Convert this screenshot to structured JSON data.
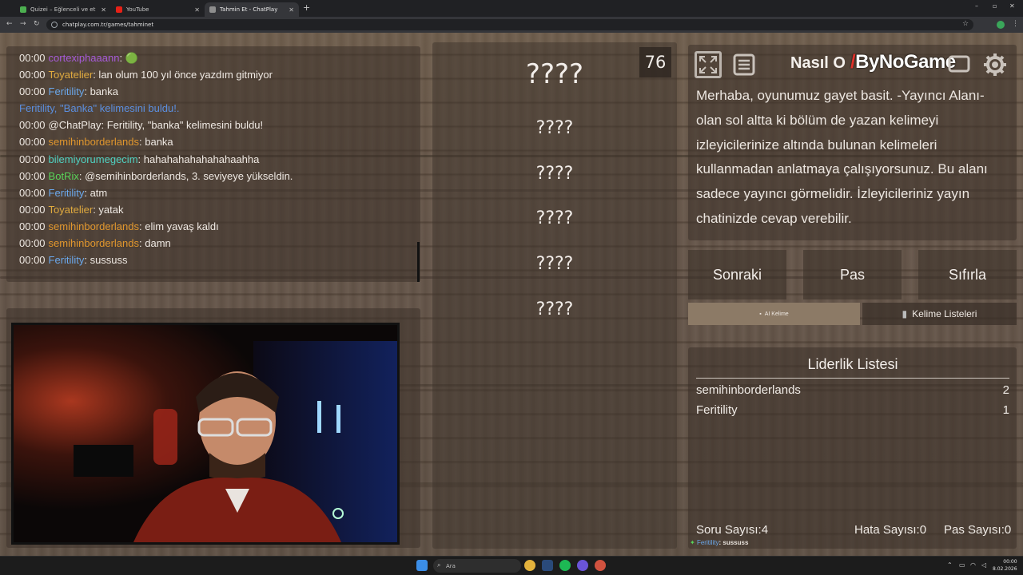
{
  "browser": {
    "tabs": [
      {
        "title": "Quizei – Eğlenceli ve etkileşimli",
        "active": false
      },
      {
        "title": "YouTube",
        "active": false
      },
      {
        "title": "Tahmin Et - ChatPlay",
        "active": true
      }
    ],
    "url": "chatplay.com.tr/games/tahminet"
  },
  "chat": {
    "lines": [
      {
        "time": "00:00",
        "user": "cortexiphaaann",
        "sep": ":",
        "msg": " 🟢",
        "color": "#a65ad8",
        "msgcolor": "#efe9e3"
      },
      {
        "time": "00:00",
        "user": "Toyatelier",
        "sep": ":",
        "msg": " lan olum 100 yıl önce yazdım gitmiyor",
        "color": "#e0aa3e",
        "msgcolor": "#efe9e3"
      },
      {
        "time": "00:00",
        "user": "Feritility",
        "sep": ":",
        "msg": " banka",
        "color": "#6aa7ea",
        "msgcolor": "#efe9e3"
      },
      {
        "time": "",
        "user": "",
        "sep": "",
        "msg": "Feritility, \"Banka\" kelimesini buldu!.",
        "color": "#6aa7ea",
        "msgcolor": "#5b8fe0"
      },
      {
        "time": "00:00",
        "user": "@ChatPlay",
        "sep": ":",
        "msg": " Feritility, \"banka\" kelimesini buldu!",
        "color": "#efe9e3",
        "msgcolor": "#efe9e3"
      },
      {
        "time": "00:00",
        "user": "semihinborderlands",
        "sep": ":",
        "msg": " banka",
        "color": "#e0962d",
        "msgcolor": "#efe9e3"
      },
      {
        "time": "00:00",
        "user": "bilemiyorumegecim",
        "sep": ":",
        "msg": " hahahahahahahahaahha",
        "color": "#4fd1c1",
        "msgcolor": "#efe9e3"
      },
      {
        "time": "00:00",
        "user": "BotRix",
        "sep": ":",
        "msg": " @semihinborderlands, 3. seviyeye yükseldin.",
        "color": "#59d65a",
        "msgcolor": "#efe9e3"
      },
      {
        "time": "00:00",
        "user": "Feritility",
        "sep": ":",
        "msg": " atm",
        "color": "#6aa7ea",
        "msgcolor": "#efe9e3"
      },
      {
        "time": "00:00",
        "user": "Toyatelier",
        "sep": ":",
        "msg": " yatak",
        "color": "#e0aa3e",
        "msgcolor": "#efe9e3"
      },
      {
        "time": "00:00",
        "user": "semihinborderlands",
        "sep": ":",
        "msg": " elim yavaş kaldı",
        "color": "#e0962d",
        "msgcolor": "#efe9e3"
      },
      {
        "time": "00:00",
        "user": "semihinborderlands",
        "sep": ":",
        "msg": " damn",
        "color": "#e0962d",
        "msgcolor": "#efe9e3"
      },
      {
        "time": "00:00",
        "user": "Feritility",
        "sep": ":",
        "msg": " sussuss",
        "color": "#6aa7ea",
        "msgcolor": "#efe9e3"
      }
    ]
  },
  "game": {
    "timer": "76",
    "words": [
      "????",
      "????",
      "????",
      "????",
      "????",
      "????"
    ]
  },
  "howto": {
    "title": "Nasıl O",
    "logo_a": "By",
    "logo_b": "NoGame",
    "text": "Merhaba, oyunumuz gayet basit. -Yayıncı Alanı- olan sol altta ki bölüm de yazan kelimeyi izleyicilerinize altında bulunan kelimeleri kullanmadan anlatmaya çalışıyorsunuz. Bu alanı sadece yayıncı görmelidir. İzleyicileriniz yayın chatinizde cevap verebilir."
  },
  "controls": {
    "next": "Sonraki",
    "pass": "Pas",
    "reset": "Sıfırla",
    "ai_word": "AI Kelime",
    "word_lists": "Kelime Listeleri"
  },
  "leaderboard": {
    "title": "Liderlik Listesi",
    "rows": [
      {
        "name": "semihinborderlands",
        "score": "2"
      },
      {
        "name": "Feritility",
        "score": "1"
      }
    ],
    "question_count": "Soru Sayısı:4",
    "error_count": "Hata Sayısı:0",
    "pass_count": "Pas Sayısı:0",
    "last_chat_user": "Feritility",
    "last_chat_msg": ": sussuss"
  },
  "taskbar": {
    "search": "Ara",
    "time": "00:00",
    "date": "8.02.2026"
  }
}
